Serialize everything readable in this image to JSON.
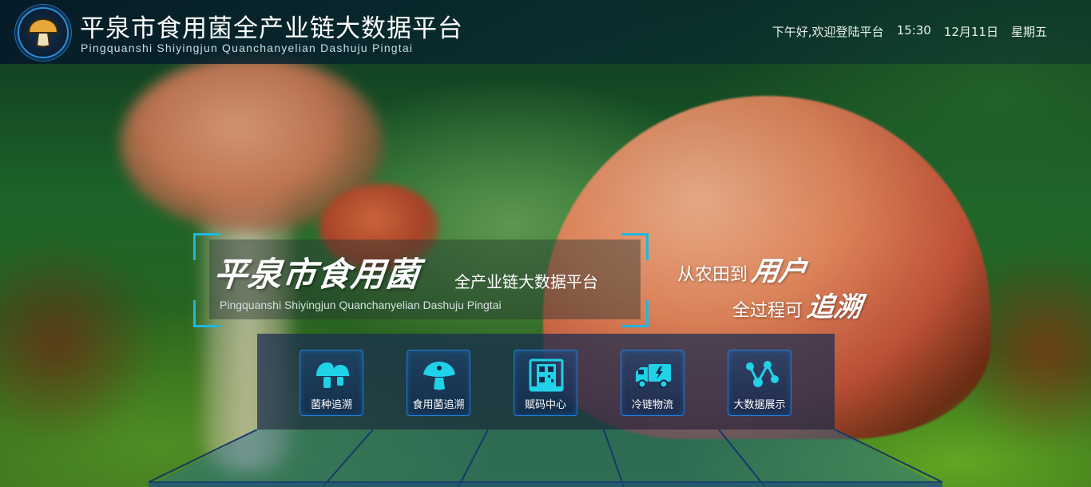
{
  "header": {
    "title": "平泉市食用菌全产业链大数据平台",
    "subtitle": "Pingquanshi Shiyingjun Quanchanyelian Dashuju Pingtai",
    "logo_icon": "mushroom-logo-icon"
  },
  "status": {
    "greeting": "下午好,欢迎登陆平台",
    "time": "15:30",
    "date": "12月11日",
    "weekday": "星期五"
  },
  "hero": {
    "brush_title": "平泉市食用菌",
    "title": "全产业链大数据平台",
    "subtitle": "Pingquanshi Shiyingjun Quanchanyelian Dashuju Pingtai"
  },
  "slogan": {
    "line1_normal": "从农田到",
    "line1_brush": "用户",
    "line2_normal": "全过程可",
    "line2_brush": "追溯"
  },
  "nav": [
    {
      "label": "菌种追溯",
      "icon": "mushroom-icon"
    },
    {
      "label": "食用菌追溯",
      "icon": "mushroom-cap-icon"
    },
    {
      "label": "赋码中心",
      "icon": "qr-code-icon"
    },
    {
      "label": "冷链物流",
      "icon": "truck-icon"
    },
    {
      "label": "大数据展示",
      "icon": "network-icon"
    }
  ],
  "colors": {
    "accent": "#1fb6e0",
    "icon": "#1fd2e8",
    "tile_border": "#1e7fd8",
    "header_bg": "#0a2233"
  }
}
